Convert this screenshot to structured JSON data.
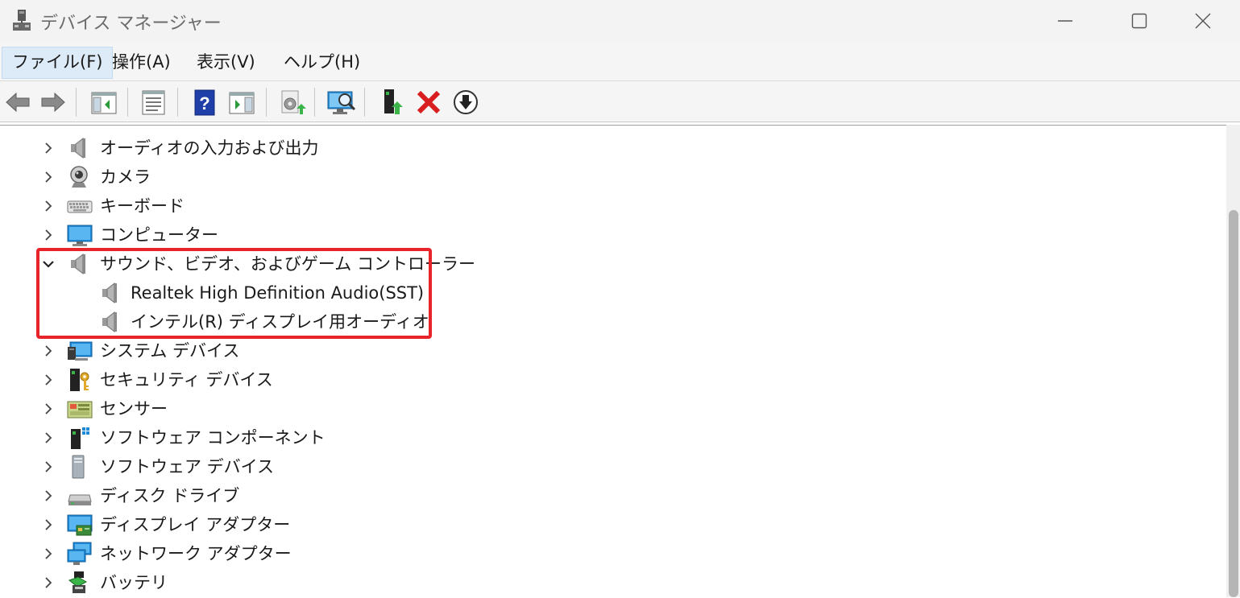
{
  "window": {
    "title": "デバイス マネージャー",
    "icons": {
      "app": "device-manager-icon",
      "minimize": "minimize-icon",
      "maximize": "maximize-icon",
      "close": "close-icon"
    }
  },
  "menu": {
    "items": [
      {
        "label": "ファイル(F)",
        "active": true
      },
      {
        "label": "操作(A)"
      },
      {
        "label": "表示(V)"
      },
      {
        "label": "ヘルプ(H)"
      }
    ]
  },
  "toolbar": {
    "buttons": [
      {
        "icon": "back-arrow-icon"
      },
      {
        "icon": "forward-arrow-icon"
      },
      {
        "icon": "show-hide-console-tree-icon"
      },
      {
        "icon": "properties-icon"
      },
      {
        "icon": "help-icon"
      },
      {
        "icon": "action-pane-icon"
      },
      {
        "icon": "update-driver-icon"
      },
      {
        "icon": "scan-hardware-changes-icon"
      },
      {
        "icon": "add-legacy-hardware-icon"
      },
      {
        "icon": "uninstall-device-icon"
      },
      {
        "icon": "download-driver-icon"
      }
    ]
  },
  "tree": {
    "items": [
      {
        "label": "オーディオの入力および出力",
        "icon": "speaker-icon",
        "expanded": false
      },
      {
        "label": "カメラ",
        "icon": "camera-icon",
        "expanded": false
      },
      {
        "label": "キーボード",
        "icon": "keyboard-icon",
        "expanded": false
      },
      {
        "label": "コンピューター",
        "icon": "computer-icon",
        "expanded": false
      },
      {
        "label": "サウンド、ビデオ、およびゲーム コントローラー",
        "icon": "speaker-icon",
        "expanded": true,
        "children": [
          {
            "label": "Realtek High Definition Audio(SST)",
            "icon": "speaker-icon"
          },
          {
            "label": "インテル(R) ディスプレイ用オーディオ",
            "icon": "speaker-icon"
          }
        ]
      },
      {
        "label": "システム デバイス",
        "icon": "system-devices-icon",
        "expanded": false
      },
      {
        "label": "セキュリティ デバイス",
        "icon": "security-key-icon",
        "expanded": false
      },
      {
        "label": "センサー",
        "icon": "sensor-icon",
        "expanded": false
      },
      {
        "label": "ソフトウェア コンポーネント",
        "icon": "software-component-icon",
        "expanded": false
      },
      {
        "label": "ソフトウェア デバイス",
        "icon": "software-device-icon",
        "expanded": false
      },
      {
        "label": "ディスク ドライブ",
        "icon": "disk-drive-icon",
        "expanded": false
      },
      {
        "label": "ディスプレイ アダプター",
        "icon": "display-adapter-icon",
        "expanded": false
      },
      {
        "label": "ネットワーク アダプター",
        "icon": "network-adapter-icon",
        "expanded": false
      },
      {
        "label": "バッテリ",
        "icon": "battery-icon",
        "expanded": false
      }
    ]
  },
  "colors": {
    "highlight_border": "#e8242a",
    "menu_active_bg": "#dcebf7"
  }
}
